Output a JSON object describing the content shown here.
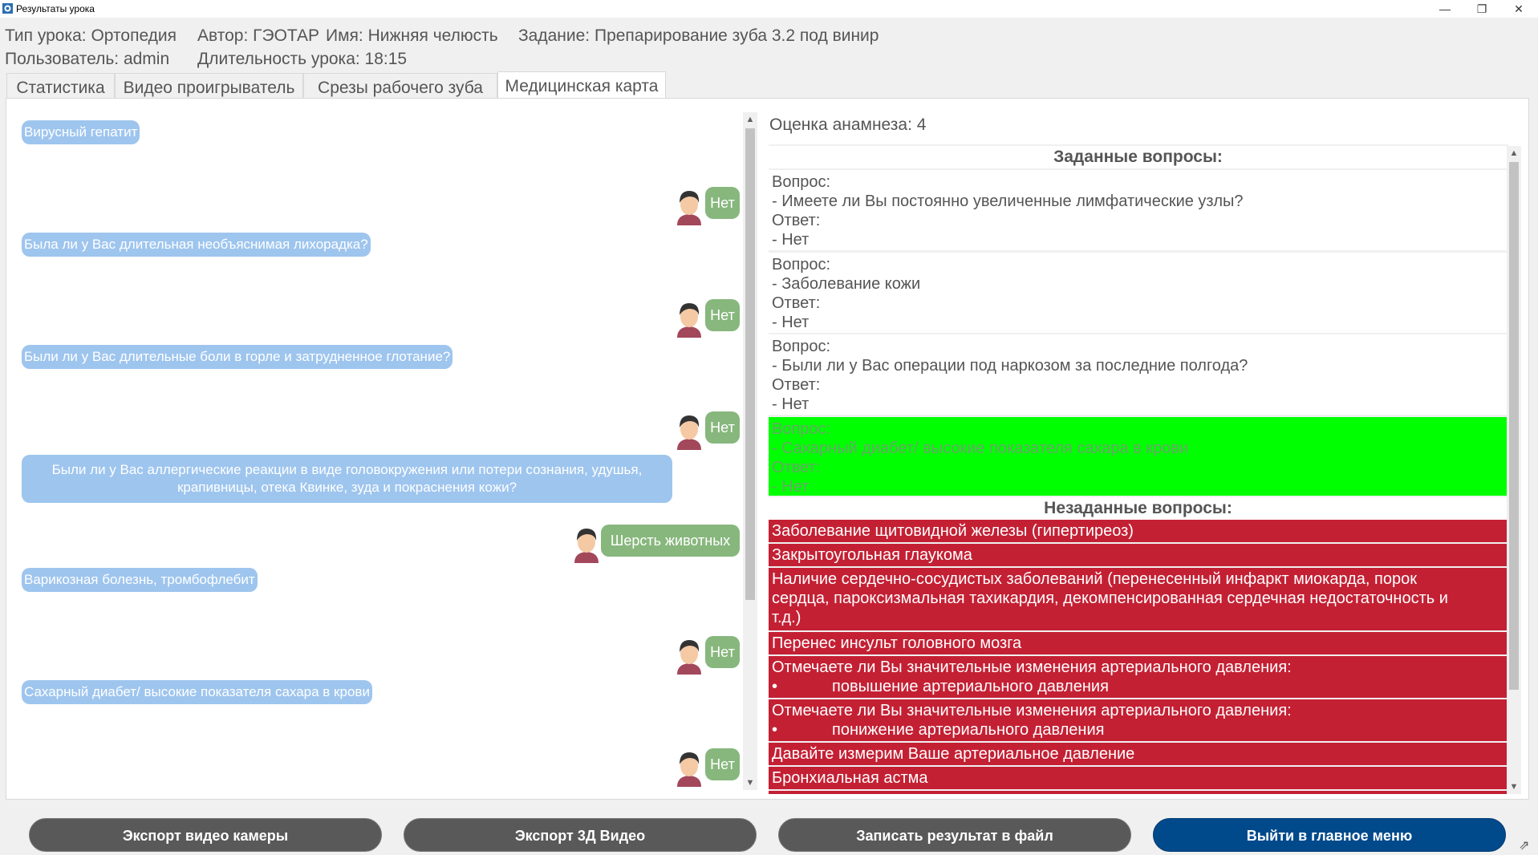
{
  "window": {
    "title": "Результаты урока"
  },
  "info": {
    "lesson_type": "Тип урока: Ортопедия",
    "author": "Автор: ГЭОТАР",
    "name": "Имя: Нижняя челюсть",
    "task": "Задание: Препарирование зуба 3.2 под винир",
    "user": "Пользователь: admin",
    "duration": "Длительность урока: 18:15"
  },
  "tabs": [
    {
      "label": "Статистика"
    },
    {
      "label": "Видео проигрыватель"
    },
    {
      "label": "Срезы рабочего зуба"
    },
    {
      "label": "Медицинская карта"
    }
  ],
  "chat": [
    {
      "q": "Вирусный гепатит",
      "a": "Нет"
    },
    {
      "q": "Была ли у Вас длительная  необъяснимая лихорадка?",
      "a": "Нет"
    },
    {
      "q": "Были ли у Вас длительные боли в горле и затрудненное глотание?",
      "a": "Нет"
    },
    {
      "q1": "Были ли у Вас аллергические реакции в виде головокружения или потери сознания, удушья,",
      "q2": "крапивницы, отека Квинке, зуда и покраснения кожи?",
      "a": "Шерсть животных"
    },
    {
      "q": "Варикозная болезнь, тромбофлебит",
      "a": "Нет"
    },
    {
      "q": "Сахарный диабет/ высокие показателя сахара в крови",
      "a": "Нет"
    }
  ],
  "anamnesis": {
    "score": "Оценка анамнеза: 4",
    "asked_header": "Заданные вопросы:",
    "question_label": "Вопрос:",
    "answer_label": "Ответ:",
    "asked": [
      {
        "q": "- Имеете ли Вы постоянно увеличенные лимфатические узлы?",
        "a": "- Нет"
      },
      {
        "q": "- Заболевание кожи",
        "a": "- Нет"
      },
      {
        "q": "- Были ли у Вас операции под наркозом за последние полгода?",
        "a": "- Нет"
      },
      {
        "q": "- Сахарный диабет/ высокие показателя сахара в крови",
        "a": "- Нет"
      }
    ],
    "unasked_header": "Незаданные вопросы:",
    "unasked": [
      "Заболевание щитовидной железы (гипертиреоз)",
      "Закрытоугольная глаукома",
      "Наличие сердечно-сосудистых заболеваний (перенесенный инфаркт миокарда, порок",
      "сердца, пароксизмальная тахикардия, декомпенсированная сердечная недостаточность и",
      "т.д.)",
      "Перенес инсульт головного мозга",
      "Отмечаете ли Вы значительные изменения артериального давления:",
      "•",
      "повышение артериального давления",
      "Отмечаете ли Вы значительные изменения артериального давления:",
      "понижение артериального давления",
      "Давайте измерим Ваше артериальное давление",
      "Бронхиальная астма"
    ]
  },
  "buttons": {
    "export_camera": "Экспорт видео камеры",
    "export_3d": "Экспорт 3Д Видео",
    "save_result": "Записать результат в файл",
    "exit_menu": "Выйти в главное меню"
  },
  "colors": {
    "question_bubble": "#9ec5ee",
    "answer_bubble": "#87b77d",
    "asked_highlight": "#00ff00",
    "unasked": "#c42034",
    "primary_button": "#004a8c",
    "secondary_button": "#595959"
  }
}
